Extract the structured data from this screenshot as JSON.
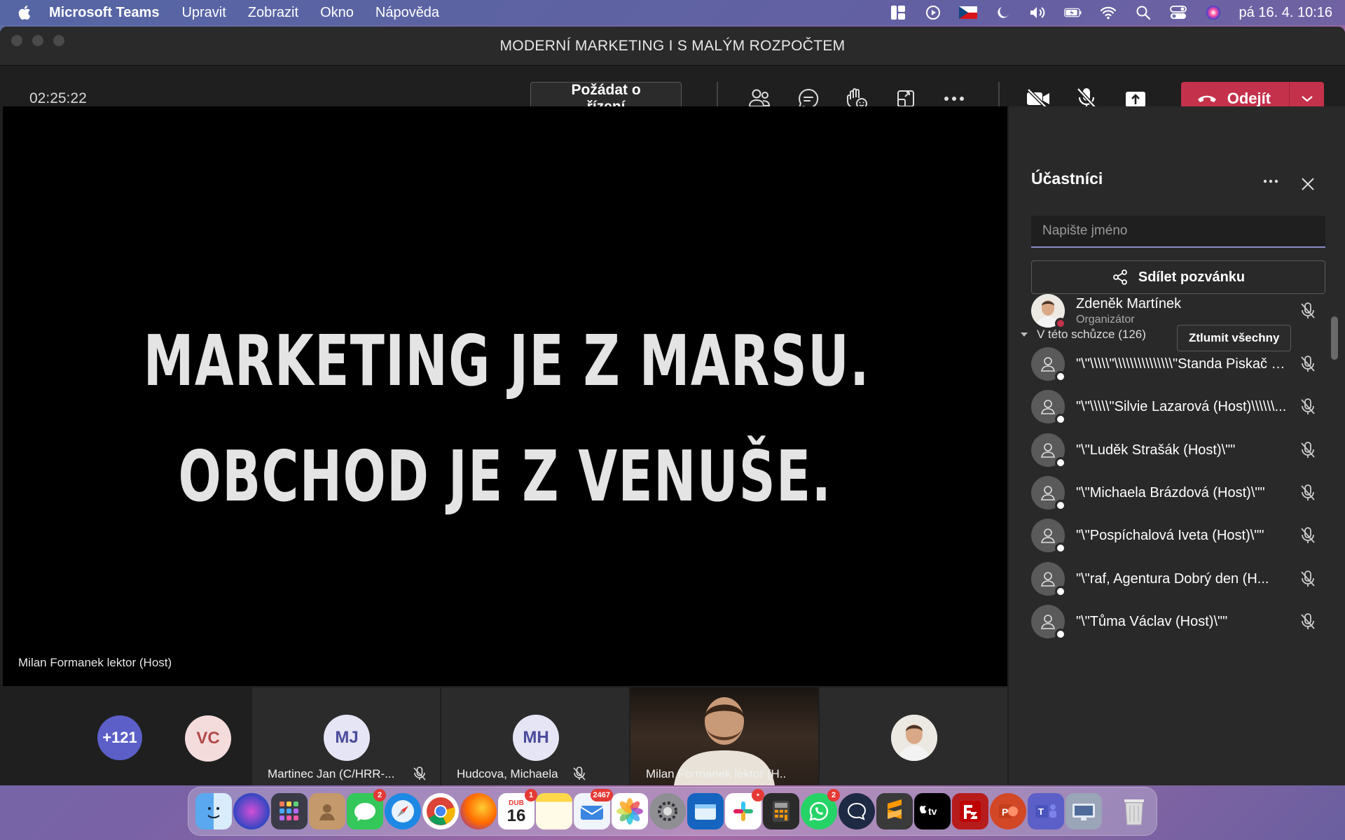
{
  "menubar": {
    "app_name": "Microsoft Teams",
    "items": [
      "Upravit",
      "Zobrazit",
      "Okno",
      "Nápověda"
    ],
    "clock": "pá 16. 4.  10:16"
  },
  "window": {
    "title": "MODERNÍ MARKETING I S MALÝM ROZPOČTEM"
  },
  "toolbar": {
    "timer": "02:25:22",
    "request_control_label": "Požádat o řízení",
    "leave_label": "Odejít"
  },
  "stage": {
    "slide_line1": "MARKETING JE Z MARSU.",
    "slide_line2": "OBCHOD JE Z VENUŠE.",
    "presenter_label": "Milan Formanek lektor (Host)"
  },
  "gallery": {
    "overflow_count": "+121",
    "vc_initials": "VC",
    "tiles": [
      {
        "initials": "MJ",
        "name": "Martinec Jan (C/HRR-..."
      },
      {
        "initials": "MH",
        "name": "Hudcova, Michaela"
      },
      {
        "initials": "",
        "name": "Milan Formanek lektor (H..."
      }
    ]
  },
  "panel": {
    "title": "Účastníci",
    "search_placeholder": "Napište jméno",
    "share_label": "Sdílet pozvánku",
    "section_label": "V této schůzce (126)",
    "mute_all_label": "Ztlumit všechny",
    "participants": [
      {
        "name": "Zdeněk Martínek",
        "role": "Organizátor"
      },
      {
        "name": "\"\\\"\\\\\\\\\\\"\\\\\\\\\\\\\\\\\\\\\\\\\\\\\\\"Standa Piskač (H...",
        "role": ""
      },
      {
        "name": "\"\\\"\\\\\\\\\\\"Silvie Lazarová (Host)\\\\\\\\\\\\...",
        "role": ""
      },
      {
        "name": "\"\\\"Luděk Strašák (Host)\\\"\"",
        "role": ""
      },
      {
        "name": "\"\\\"Michaela Brázdová (Host)\\\"\"",
        "role": ""
      },
      {
        "name": "\"\\\"Pospíchalová Iveta (Host)\\\"\"",
        "role": ""
      },
      {
        "name": "\"\\\"raf, Agentura Dobrý den (H...",
        "role": ""
      },
      {
        "name": "\"\\\"Tůma Václav (Host)\\\"\"",
        "role": ""
      }
    ]
  },
  "dock": {
    "calendar_month": "DUB",
    "calendar_day": "16",
    "messages_badge": "2",
    "calendar_badge": "1",
    "mail_badge": "2467",
    "slack_badge": "•",
    "whatsapp_badge": "2"
  },
  "colors": {
    "accent": "#8b8cc7",
    "leave": "#c4314b",
    "panel_bg": "#292929",
    "stage_bg": "#000000"
  }
}
